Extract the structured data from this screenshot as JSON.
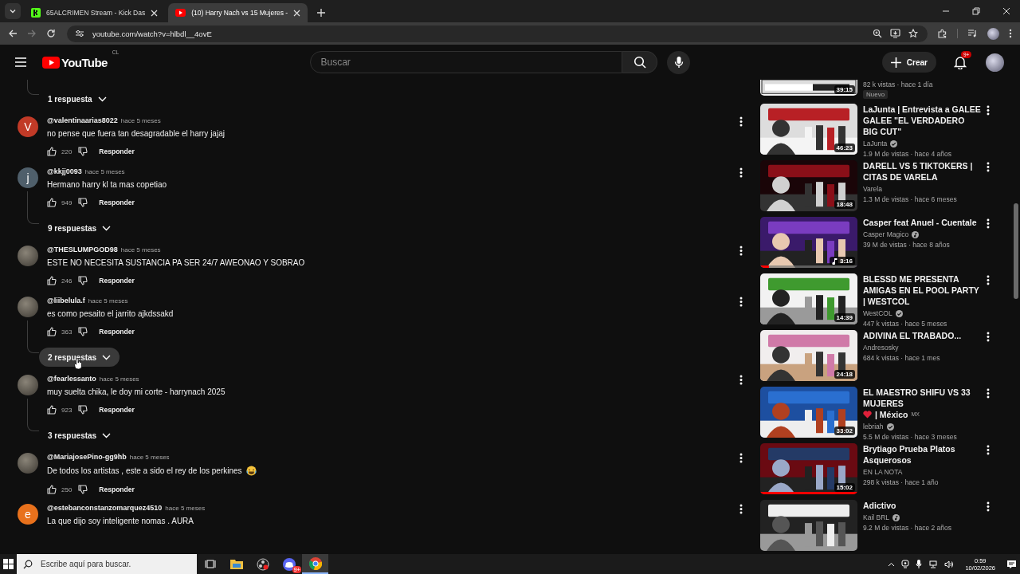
{
  "browser": {
    "tabs": [
      {
        "title": "65ALCRIMEN Stream - Kick Das",
        "kind": "kick",
        "selected": false
      },
      {
        "title": "(10) Harry Nach vs 15 Mujeres -",
        "kind": "youtube",
        "selected": true
      }
    ],
    "url": "youtube.com/watch?v=hlbdl__4ovE"
  },
  "header": {
    "logo": "YouTube",
    "region": "CL",
    "search": {
      "placeholder": "Buscar"
    },
    "create": "Crear",
    "notifications": "9+"
  },
  "comments": [
    {
      "kind": "replies",
      "label": "1 respuesta",
      "hovered": false
    },
    {
      "kind": "comment",
      "author": "@valentinaarias8022",
      "time": "hace 5 meses",
      "text": "no pense que fuera tan desagradable el harry jajaj",
      "likes": "220",
      "reply": "Responder",
      "avatar": {
        "kind": "letter",
        "letter": "V",
        "color": "#c13a27"
      },
      "thread": false,
      "emoji": false
    },
    {
      "kind": "comment",
      "author": "@kkjj0093",
      "time": "hace 5 meses",
      "text": "Hermano harry kl ta mas copetiao",
      "likes": "949",
      "reply": "Responder",
      "avatar": {
        "kind": "letter",
        "letter": "j",
        "color": "#4f5f6b"
      },
      "thread": true,
      "emoji": false
    },
    {
      "kind": "replies",
      "label": "9 respuestas",
      "hovered": false
    },
    {
      "kind": "comment",
      "author": "@THESLUMPGOD98",
      "time": "hace 5 meses",
      "text": "ESTE NO NECESITA SUSTANCIA PA SER 24/7 AWEONAO Y SOBRAO",
      "likes": "246",
      "reply": "Responder",
      "thread": false,
      "emoji": false
    },
    {
      "kind": "comment",
      "author": "@liibelula.f",
      "time": "hace 5 meses",
      "text": "es como pesaito el jarrito ajkdssakd",
      "likes": "363",
      "reply": "Responder",
      "thread": true,
      "emoji": false
    },
    {
      "kind": "replies",
      "label": "2 respuestas",
      "hovered": true
    },
    {
      "kind": "comment",
      "author": "@fearlessanto",
      "time": "hace 5 meses",
      "text": "muy suelta chika, le doy mi corte - harrynach 2025",
      "likes": "923",
      "reply": "Responder",
      "thread": true,
      "emoji": false
    },
    {
      "kind": "replies",
      "label": "3 respuestas",
      "hovered": false
    },
    {
      "kind": "comment",
      "author": "@MariajosePino-gg9hb",
      "time": "hace 5 meses",
      "text": "De todos los artistas , este a sido el rey de los perkines",
      "likes": "250",
      "reply": "Responder",
      "thread": false,
      "emoji": true
    },
    {
      "kind": "comment",
      "author": "@estebanconstanzomarquez4510",
      "time": "hace 5 meses",
      "text": "La que dijo soy inteligente nomas . AURA",
      "avatar": {
        "kind": "letter",
        "letter": "e",
        "color": "#e8711c"
      },
      "thread": false,
      "emoji": false
    }
  ],
  "related": [
    {
      "kind": "partial",
      "duration": "39:15",
      "stats": "82 k vistas · hace 1 día",
      "tag": "Nuevo"
    },
    {
      "kind": "video",
      "title": "LaJunta | Entrevista a GALEE GALEE \"EL VERDADERO BIG CUT\"",
      "channel": "LaJunta",
      "verified": true,
      "stats": "1.9 M de vistas · hace 4 años",
      "duration": "46:23"
    },
    {
      "kind": "video",
      "title": "DARELL VS 5 TIKTOKERS | CITAS DE VARELA",
      "channel": "Varela",
      "stats": "1.3 M de vistas · hace 6 meses",
      "duration": "18:48"
    },
    {
      "kind": "video",
      "title": "Casper feat Anuel - Cuentale",
      "channel": "Casper Magico",
      "artist": true,
      "stats": "39 M de vistas · hace 8 años",
      "duration": "3:16",
      "music": true,
      "level": 0.09
    },
    {
      "kind": "video",
      "title": "BLESSD ME PRESENTA AMIGAS EN EL POOL PARTY | WESTCOL",
      "channel": "WestCOL",
      "verified": true,
      "stats": "447 k vistas · hace 5 meses",
      "duration": "14:39"
    },
    {
      "kind": "video",
      "title": "ADIVINA EL TRABADO...",
      "channel": "Andresosky",
      "stats": "684 k vistas · hace 1 mes",
      "duration": "24:18"
    },
    {
      "kind": "video",
      "title": "EL MAESTRO SHIFU VS 33 MUJERES",
      "heart": true,
      "title_end": "| México",
      "flag": "MX",
      "channel": "lebriah",
      "verified": true,
      "stats": "5.5 M de vistas · hace 3 meses",
      "duration": "33:02"
    },
    {
      "kind": "video",
      "title": "Brytiago Prueba Platos Asquerosos",
      "channel": "EN LA NOTA",
      "stats": "298 k vistas · hace 1 año",
      "duration": "15:02",
      "level": 1
    },
    {
      "kind": "video",
      "title": "Adictivo",
      "channel": "Kail BRL",
      "artist": true,
      "stats": "9.2 M de vistas · hace 2 años"
    }
  ],
  "taskbar": {
    "search": {
      "placeholder": "Escribe aquí para buscar."
    },
    "apps": [
      {
        "kind": "taskview",
        "selected": false
      },
      {
        "kind": "explorer",
        "selected": false
      },
      {
        "kind": "obs",
        "selected": false
      },
      {
        "kind": "discord",
        "selected": false,
        "badge": "9+"
      },
      {
        "kind": "chrome",
        "selected": true
      }
    ],
    "time": "0:59",
    "date": "10/02/2026"
  }
}
